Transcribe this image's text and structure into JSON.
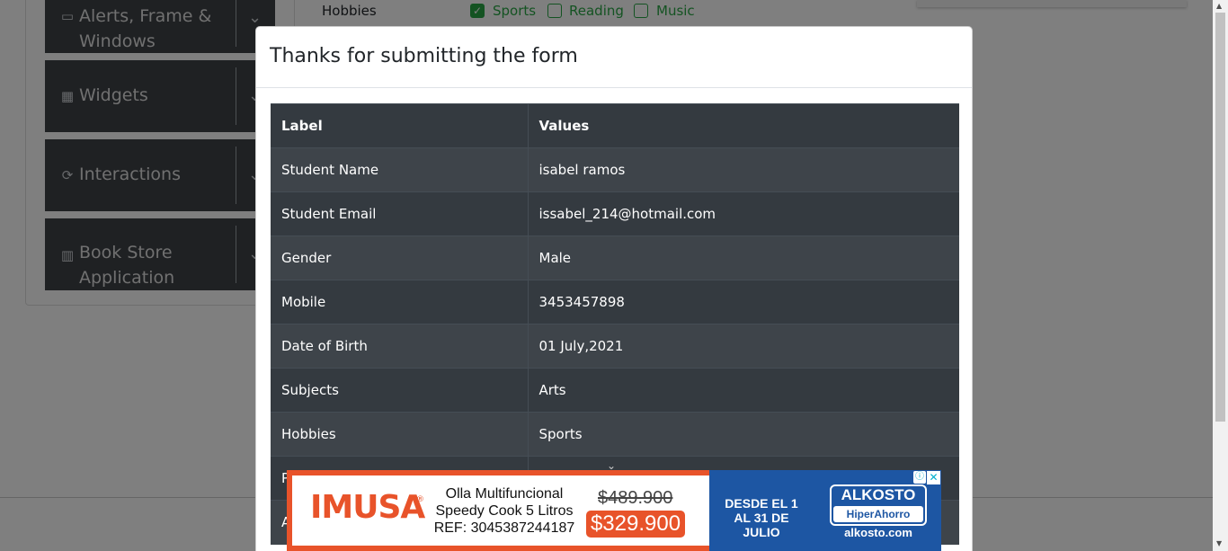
{
  "sidebar": {
    "groups": [
      {
        "label": "Alerts, Frame & Windows",
        "icon": "window-icon"
      },
      {
        "label": "Widgets",
        "icon": "widgets-icon"
      },
      {
        "label": "Interactions",
        "icon": "interactions-icon"
      },
      {
        "label": "Book Store Application",
        "icon": "book-icon"
      }
    ]
  },
  "form_bg": {
    "hobbies_label": "Hobbies",
    "options": [
      {
        "label": "Sports",
        "checked": true
      },
      {
        "label": "Reading",
        "checked": false
      },
      {
        "label": "Music",
        "checked": false
      }
    ]
  },
  "modal": {
    "title": "Thanks for submitting the form",
    "table": {
      "headers": [
        "Label",
        "Values"
      ],
      "rows": [
        [
          "Student Name",
          "isabel ramos"
        ],
        [
          "Student Email",
          "issabel_214@hotmail.com"
        ],
        [
          "Gender",
          "Male"
        ],
        [
          "Mobile",
          "3453457898"
        ],
        [
          "Date of Birth",
          "01 July,2021"
        ],
        [
          "Subjects",
          "Arts"
        ],
        [
          "Hobbies",
          "Sports"
        ],
        [
          "P",
          ""
        ],
        [
          "A",
          ""
        ]
      ]
    }
  },
  "ad": {
    "brand_logo": "IMUSA",
    "reg_mark": "®",
    "product_line1": "Olla Multifuncional",
    "product_line2": "Speedy Cook 5 Litros",
    "product_line3": "REF: 3045387244187",
    "old_price": "$489.900",
    "new_price": "$329.900",
    "date_line1": "DESDE EL 1",
    "date_line2": "AL 31 DE JULIO",
    "store_name": "ALKOSTO",
    "store_sub": "HiperAhorro",
    "store_url": "alkosto.com",
    "info_icon": "info-icon",
    "close_icon": "close-icon"
  },
  "colors": {
    "sidebar_bg": "#3e4247",
    "accent_green": "#28a745",
    "table_dark": "#343a40",
    "table_stripe": "#3e444a",
    "ad_orange": "#e8532a",
    "ad_blue": "#1d56a3"
  }
}
